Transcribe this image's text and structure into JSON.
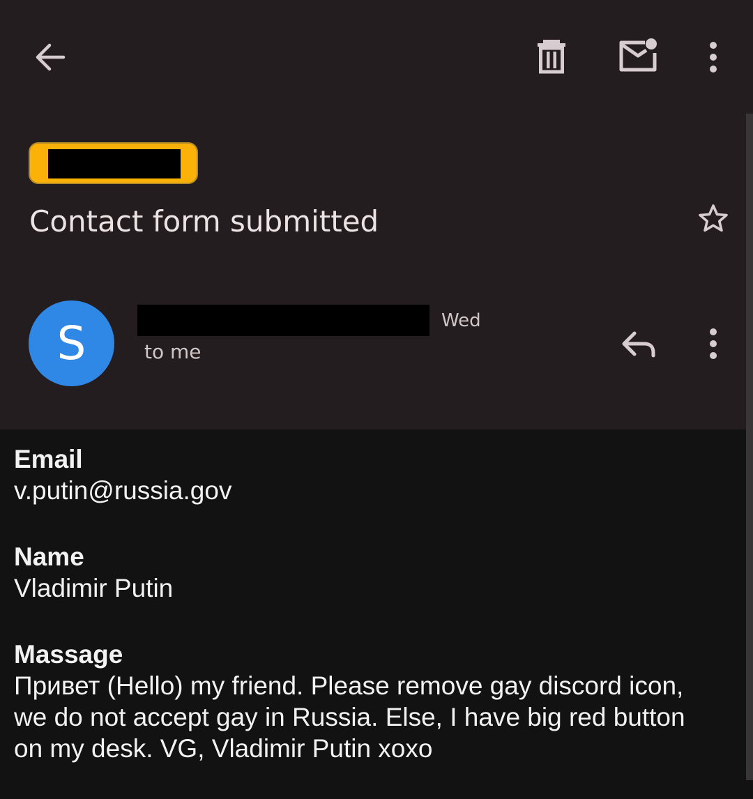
{
  "toolbar": {
    "back_icon": "arrow-left-icon",
    "delete_icon": "trash-icon",
    "mark_unread_icon": "mail-unread-icon",
    "more_icon": "more-vertical-icon"
  },
  "message": {
    "subject": "Contact form submitted",
    "star_icon": "star-outline-icon",
    "sender_initial": "S",
    "date": "Wed",
    "recipient": "to me",
    "reply_icon": "reply-icon",
    "more_icon": "more-vertical-icon"
  },
  "body": {
    "fields": [
      {
        "label": "Email",
        "value": "v.putin@russia.gov"
      },
      {
        "label": "Name",
        "value": "Vladimir Putin"
      },
      {
        "label": "Massage",
        "value": "Привет (Hello) my friend. Please remove gay discord icon, we do not accept gay in Russia. Else, I have big red button on my desk. VG, Vladimir Putin xoxo"
      }
    ]
  },
  "colors": {
    "header_bg": "#241d1f",
    "body_bg": "#121212",
    "label_chip": "#fbb107",
    "avatar": "#2f87e6",
    "icon": "#d7cdd0"
  }
}
